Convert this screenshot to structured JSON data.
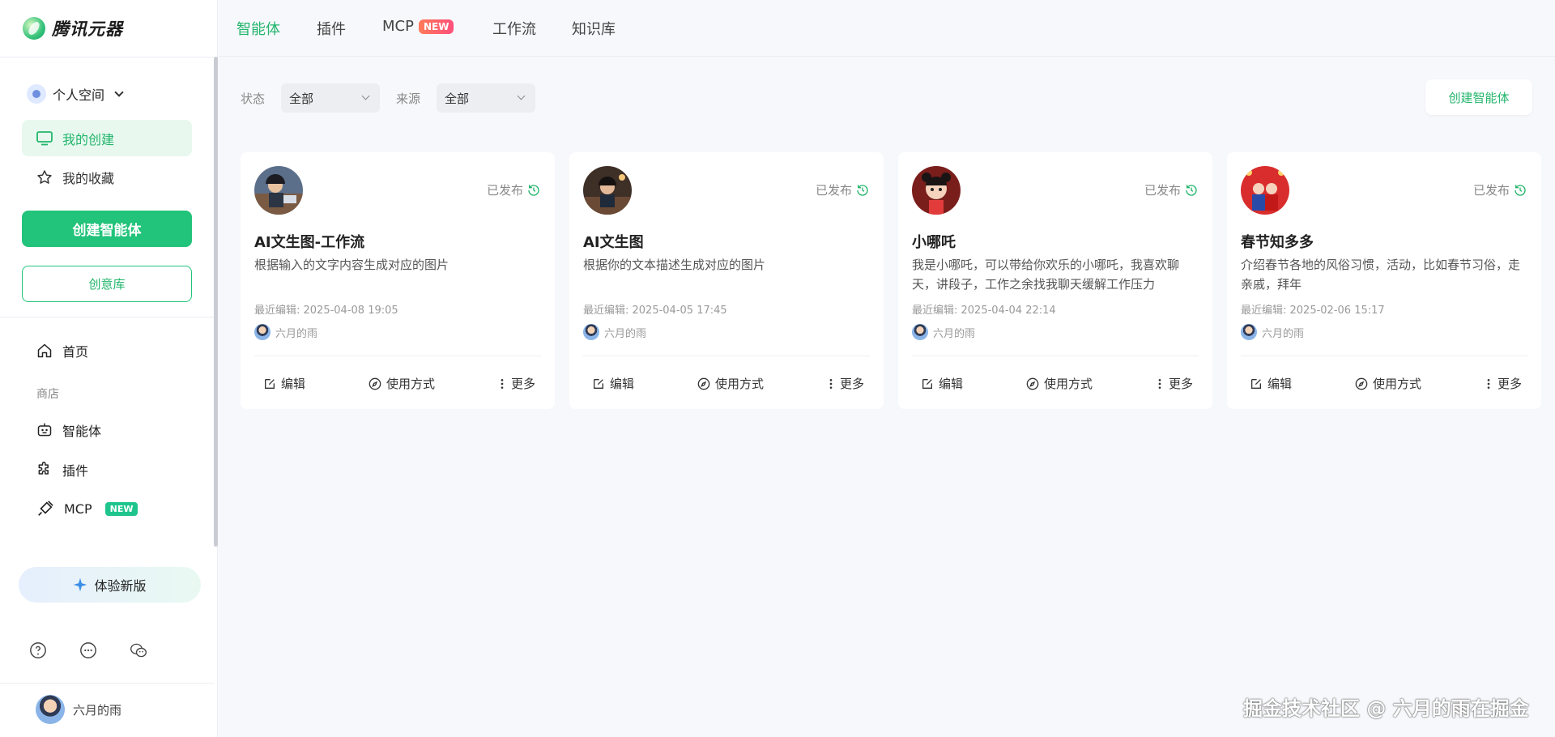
{
  "app": {
    "brand": "腾讯元器"
  },
  "top_nav": {
    "tabs": [
      {
        "label": "智能体"
      },
      {
        "label": "插件"
      },
      {
        "label": "MCP",
        "badge": "NEW"
      },
      {
        "label": "工作流"
      },
      {
        "label": "知识库"
      }
    ]
  },
  "sidebar": {
    "space": "个人空间",
    "my_items": [
      {
        "label": "我的创建"
      },
      {
        "label": "我的收藏"
      }
    ],
    "create_button": "创建智能体",
    "idea_button": "创意库",
    "home": "首页",
    "store_label": "商店",
    "store_items": [
      {
        "label": "智能体"
      },
      {
        "label": "插件"
      },
      {
        "label": "MCP",
        "badge": "NEW"
      }
    ],
    "trial_button": "体验新版",
    "user_name": "六月的雨"
  },
  "filters": {
    "status_label": "状态",
    "status_value": "全部",
    "source_label": "来源",
    "source_value": "全部",
    "create_button": "创建智能体"
  },
  "cards": [
    {
      "title": "AI文生图-工作流",
      "status": "已发布",
      "description": "根据输入的文字内容生成对应的图片",
      "last_edit": "最近编辑: 2025-04-08 19:05",
      "owner": "六月的雨"
    },
    {
      "title": "AI文生图",
      "status": "已发布",
      "description": "根据你的文本描述生成对应的图片",
      "last_edit": "最近编辑: 2025-04-05 17:45",
      "owner": "六月的雨"
    },
    {
      "title": "小哪吒",
      "status": "已发布",
      "description": "我是小哪吒，可以带给你欢乐的小哪吒，我喜欢聊天，讲段子，工作之余找我聊天缓解工作压力",
      "last_edit": "最近编辑: 2025-04-04 22:14",
      "owner": "六月的雨"
    },
    {
      "title": "春节知多多",
      "status": "已发布",
      "description": "介绍春节各地的风俗习惯，活动，比如春节习俗，走亲戚，拜年",
      "last_edit": "最近编辑: 2025-02-06 15:17",
      "owner": "六月的雨"
    }
  ],
  "card_actions": {
    "edit": "编辑",
    "usage": "使用方式",
    "more": "更多"
  },
  "watermark": "掘金技术社区 @ 六月的雨在掘金",
  "colors": {
    "accent": "#22c37a",
    "background": "#f7f8fc"
  }
}
